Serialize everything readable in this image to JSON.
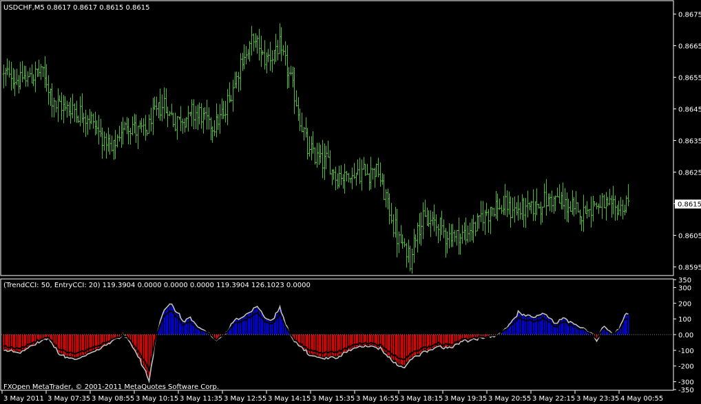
{
  "main_header": "USDCHF,M5  0.8617 0.8617 0.8615 0.8615",
  "indicator_header": "(TrendCCI: 50, EntryCCI: 20)  119.3904 0.0000 0.0000 0.0000 119.3904 126.1023 0.0000",
  "copyright": "FXOpen MetaTrader, © 2001-2011 MetaQuotes Software Corp.",
  "colors": {
    "background": "#000000",
    "frame": "#ffffff",
    "bars": "#4bbf2e",
    "cci_positive": "#0000ff",
    "cci_negative": "#ff0000",
    "cci_transition": "#ffcc00",
    "trend_line": "#000000",
    "entry_line": "#c0c0c0",
    "price_tag_bg": "#ffffff",
    "price_tag_text": "#000000"
  },
  "chart_data": [
    {
      "type": "ohlc-bars",
      "symbol": "USDCHF",
      "timeframe": "M5",
      "ylim": [
        0.85925,
        0.8679
      ],
      "y_ticks": [
        "0.8675",
        "0.8665",
        "0.8655",
        "0.8645",
        "0.8635",
        "0.8625",
        "0.8615",
        "0.8605",
        "0.8595"
      ],
      "current_price": "0.8615",
      "anchors": [
        [
          0,
          0.8656
        ],
        [
          10,
          0.8654
        ],
        [
          20,
          0.8657
        ],
        [
          28,
          0.8646
        ],
        [
          38,
          0.8645
        ],
        [
          48,
          0.8641
        ],
        [
          58,
          0.8631
        ],
        [
          66,
          0.8641
        ],
        [
          75,
          0.8637
        ],
        [
          85,
          0.8647
        ],
        [
          92,
          0.8641
        ],
        [
          103,
          0.8644
        ],
        [
          111,
          0.864
        ],
        [
          118,
          0.8643
        ],
        [
          126,
          0.8658
        ],
        [
          134,
          0.8667
        ],
        [
          140,
          0.8661
        ],
        [
          148,
          0.8664
        ],
        [
          153,
          0.8656
        ],
        [
          163,
          0.8632
        ],
        [
          174,
          0.8628
        ],
        [
          178,
          0.8624
        ],
        [
          185,
          0.8624
        ],
        [
          200,
          0.8626
        ],
        [
          212,
          0.8603
        ],
        [
          218,
          0.8598
        ],
        [
          222,
          0.8609
        ],
        [
          232,
          0.8609
        ],
        [
          238,
          0.8605
        ],
        [
          248,
          0.8605
        ],
        [
          262,
          0.8614
        ],
        [
          278,
          0.8613
        ],
        [
          288,
          0.8615
        ],
        [
          295,
          0.8617
        ],
        [
          308,
          0.8612
        ],
        [
          317,
          0.8615
        ],
        [
          326,
          0.8613
        ],
        [
          331,
          0.8614
        ],
        [
          335,
          0.8615
        ]
      ],
      "bar_count": 336
    },
    {
      "type": "histogram",
      "name": "TrendCCI",
      "ylim": [
        -350,
        350
      ],
      "y_ticks": [
        "350",
        "300",
        "200",
        "100",
        "0.00",
        "-100",
        "-200",
        "-300",
        "-350"
      ],
      "last_values": [
        "119.3904",
        "126.1023"
      ],
      "anchors": [
        [
          0,
          -90
        ],
        [
          8,
          -110
        ],
        [
          16,
          -60
        ],
        [
          24,
          -20
        ],
        [
          30,
          -120
        ],
        [
          38,
          -150
        ],
        [
          46,
          -110
        ],
        [
          54,
          -70
        ],
        [
          60,
          -30
        ],
        [
          64,
          0
        ],
        [
          68,
          -50
        ],
        [
          74,
          -170
        ],
        [
          78,
          -270
        ],
        [
          82,
          10
        ],
        [
          86,
          150
        ],
        [
          90,
          180
        ],
        [
          96,
          80
        ],
        [
          100,
          100
        ],
        [
          104,
          40
        ],
        [
          110,
          10
        ],
        [
          114,
          -40
        ],
        [
          120,
          20
        ],
        [
          124,
          90
        ],
        [
          130,
          120
        ],
        [
          136,
          170
        ],
        [
          140,
          100
        ],
        [
          144,
          80
        ],
        [
          148,
          160
        ],
        [
          152,
          40
        ],
        [
          156,
          -40
        ],
        [
          164,
          -120
        ],
        [
          172,
          -140
        ],
        [
          180,
          -130
        ],
        [
          188,
          -80
        ],
        [
          194,
          -60
        ],
        [
          202,
          -80
        ],
        [
          208,
          -150
        ],
        [
          214,
          -200
        ],
        [
          218,
          -150
        ],
        [
          224,
          -110
        ],
        [
          232,
          -70
        ],
        [
          240,
          -80
        ],
        [
          246,
          -40
        ],
        [
          256,
          -20
        ],
        [
          264,
          -10
        ],
        [
          270,
          40
        ],
        [
          276,
          130
        ],
        [
          284,
          100
        ],
        [
          290,
          130
        ],
        [
          296,
          60
        ],
        [
          300,
          100
        ],
        [
          306,
          60
        ],
        [
          314,
          20
        ],
        [
          318,
          -30
        ],
        [
          322,
          50
        ],
        [
          326,
          10
        ],
        [
          330,
          30
        ],
        [
          333,
          120
        ],
        [
          335,
          119
        ]
      ],
      "bar_count": 336
    }
  ],
  "x_ticks": [
    "3 May 2011",
    "3 May 07:35",
    "3 May 08:55",
    "3 May 10:15",
    "3 May 11:35",
    "3 May 12:55",
    "3 May 14:15",
    "3 May 15:35",
    "3 May 16:55",
    "3 May 18:15",
    "3 May 19:35",
    "3 May 20:55",
    "3 May 22:15",
    "3 May 23:35",
    "4 May 00:55"
  ]
}
